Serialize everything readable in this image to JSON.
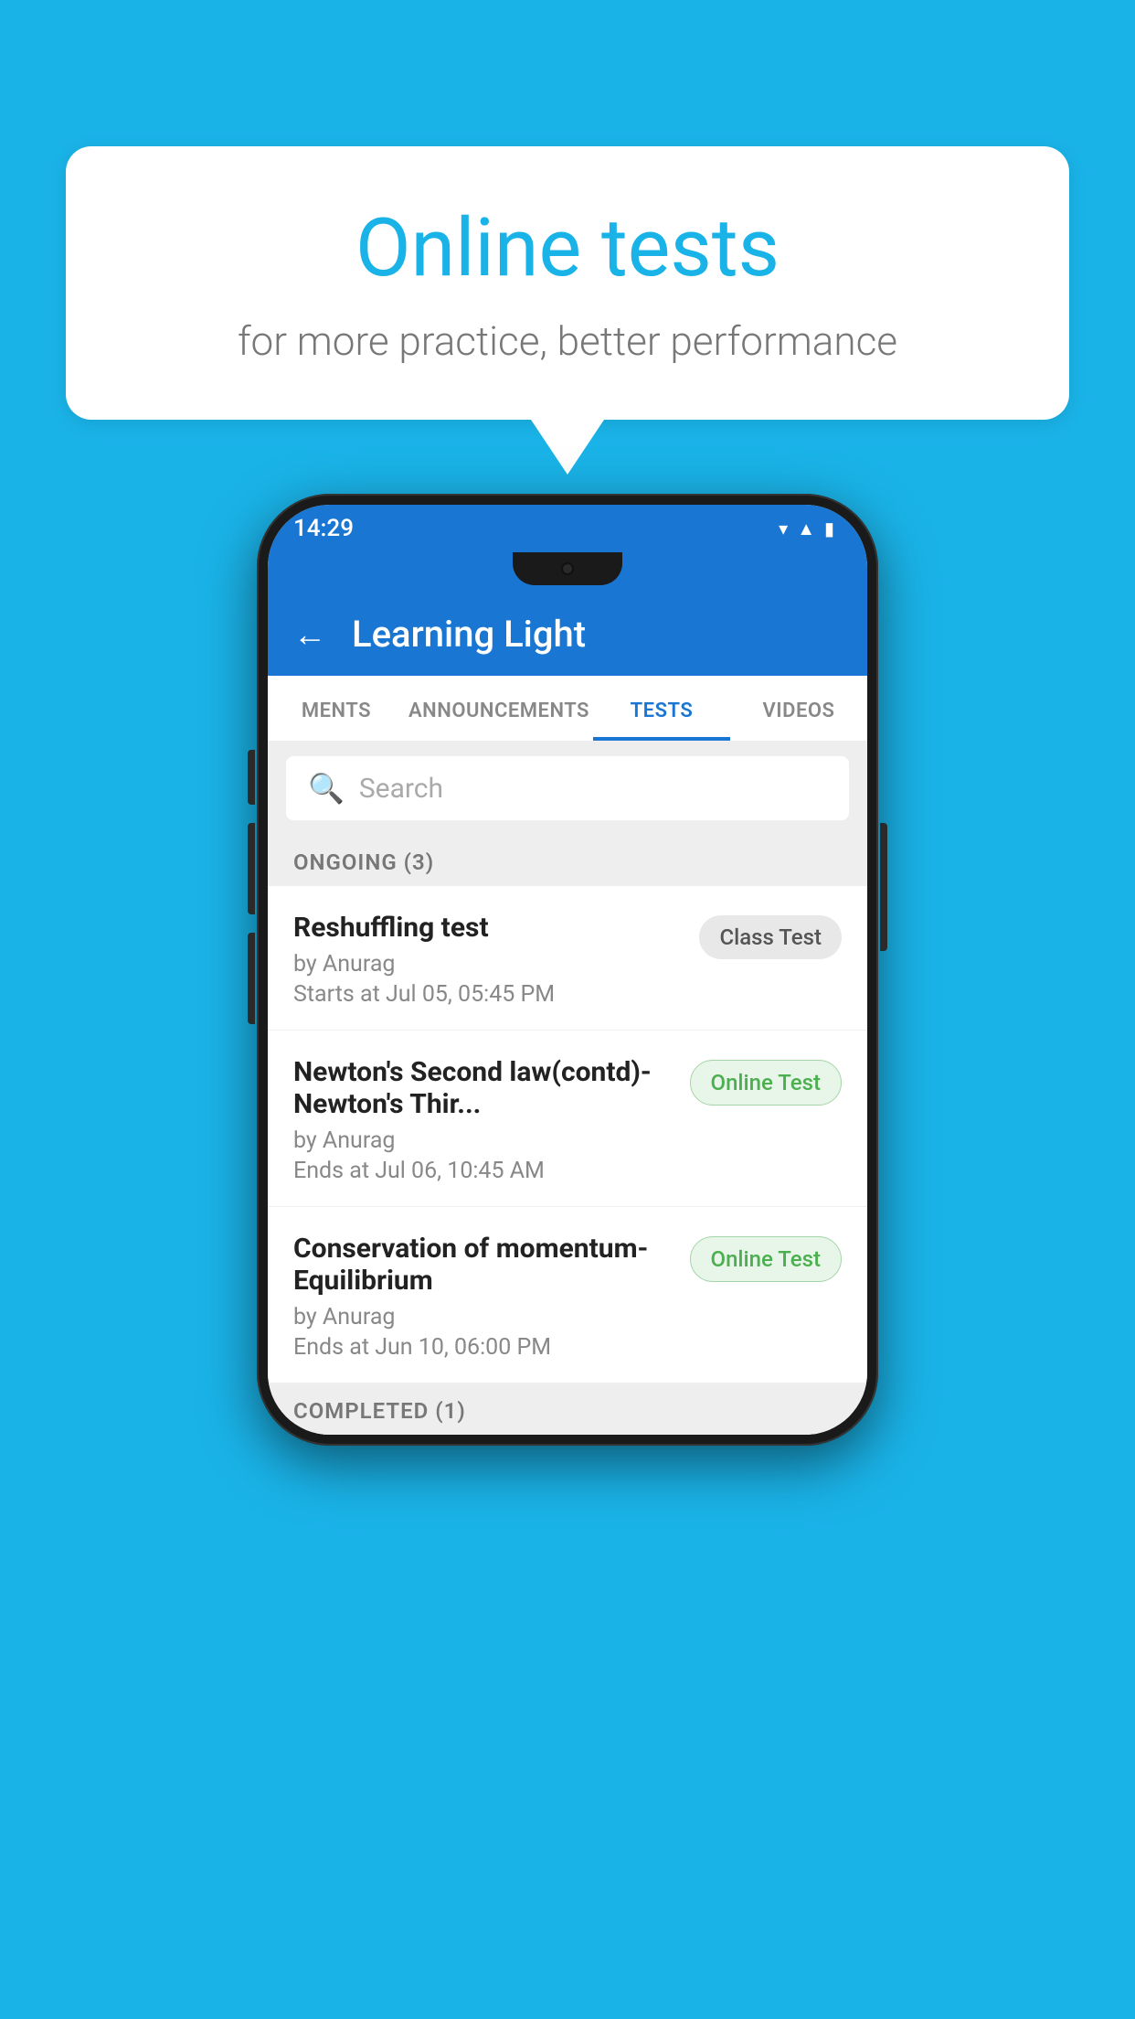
{
  "background_color": "#1ab3e8",
  "speech_bubble": {
    "title": "Online tests",
    "subtitle": "for more practice, better performance"
  },
  "phone": {
    "status_bar": {
      "time": "14:29",
      "icons": [
        "wifi",
        "signal",
        "battery"
      ]
    },
    "app_header": {
      "title": "Learning Light",
      "back_label": "←"
    },
    "tabs": [
      {
        "label": "MENTS",
        "active": false
      },
      {
        "label": "ANNOUNCEMENTS",
        "active": false
      },
      {
        "label": "TESTS",
        "active": true
      },
      {
        "label": "VIDEOS",
        "active": false
      }
    ],
    "search": {
      "placeholder": "Search"
    },
    "ongoing_section": {
      "header": "ONGOING (3)",
      "items": [
        {
          "name": "Reshuffling test",
          "author": "by Anurag",
          "date": "Starts at  Jul 05, 05:45 PM",
          "badge": "Class Test",
          "badge_type": "class"
        },
        {
          "name": "Newton's Second law(contd)-Newton's Thir...",
          "author": "by Anurag",
          "date": "Ends at  Jul 06, 10:45 AM",
          "badge": "Online Test",
          "badge_type": "online"
        },
        {
          "name": "Conservation of momentum-Equilibrium",
          "author": "by Anurag",
          "date": "Ends at  Jun 10, 06:00 PM",
          "badge": "Online Test",
          "badge_type": "online"
        }
      ]
    },
    "completed_section": {
      "header": "COMPLETED (1)"
    }
  }
}
